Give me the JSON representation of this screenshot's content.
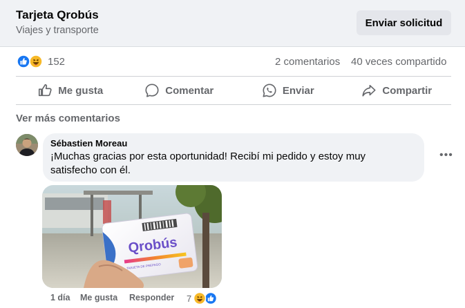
{
  "header": {
    "page_title": "Tarjeta Qrobús",
    "page_category": "Viajes y transporte",
    "send_request_label": "Enviar solicitud"
  },
  "stats": {
    "reaction_icons": [
      "like-icon",
      "haha-icon"
    ],
    "reaction_count": "152",
    "comments_label": "2 comentarios",
    "shares_label": "40 veces compartido"
  },
  "actions": [
    {
      "label": "Me gusta",
      "icon": "thumbs-up-icon"
    },
    {
      "label": "Comentar",
      "icon": "comment-icon"
    },
    {
      "label": "Enviar",
      "icon": "whatsapp-icon"
    },
    {
      "label": "Compartir",
      "icon": "share-icon"
    }
  ],
  "comments_section": {
    "more_comments_label": "Ver más comentarios",
    "comment": {
      "author": "Sébastien Moreau",
      "text": "¡Muchas gracias por esta oportunidad! Recibí mi pedido y estoy muy satisfecho con él.",
      "attachment": {
        "brand_text": "Qrobús",
        "card_caption": "TARJETA DE PREPAGO"
      },
      "time": "1 día",
      "like_label": "Me gusta",
      "reply_label": "Responder",
      "reaction_count": "7",
      "reaction_icons": [
        "haha-icon",
        "like-icon"
      ],
      "more_options_icon": "more-options-icon"
    }
  },
  "colors": {
    "header_bg": "#f0f2f5",
    "secondary_text": "#65676b",
    "like_blue": "#1877f2",
    "haha_yellow": "#f7b928",
    "qrobus_purple": "#6a4fc8"
  }
}
